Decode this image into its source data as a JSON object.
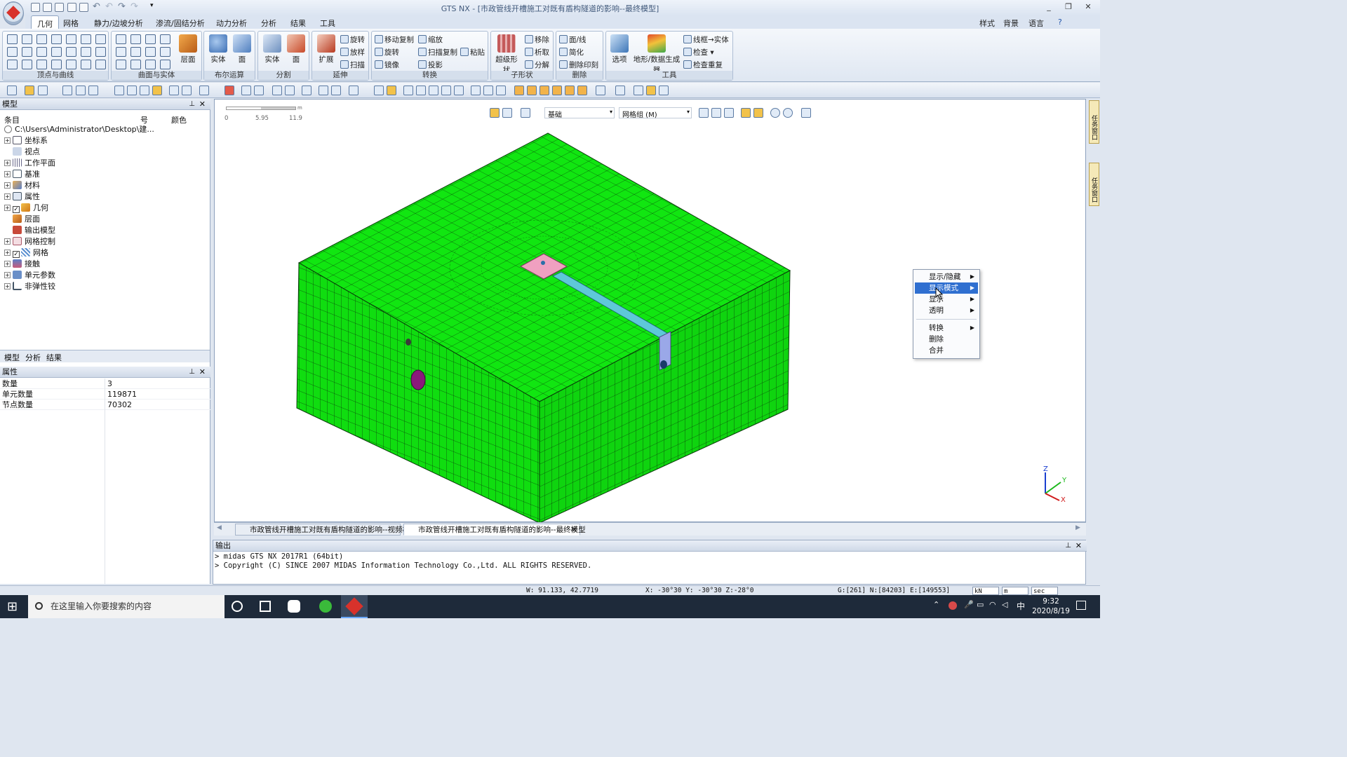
{
  "window": {
    "title": "GTS NX - [市政管线开槽施工对既有盾构隧道的影响--最终模型]",
    "controls": [
      "_",
      "❐",
      "✕"
    ]
  },
  "menu": {
    "tabs": [
      "几何",
      "网格",
      "静力/边坡分析",
      "渗流/固结分析",
      "动力分析",
      "分析",
      "结果",
      "工具"
    ],
    "right": [
      "样式",
      "背景",
      "语言"
    ]
  },
  "ribbon": {
    "groups": [
      "顶点与曲线",
      "曲面与实体",
      "布尔运算",
      "分割",
      "延伸",
      "转换",
      "子形状",
      "删除",
      "工具"
    ],
    "big_buttons": {
      "layer": "层面",
      "solid": "实体",
      "face": "面",
      "split_solid": "实体",
      "split_face": "面",
      "extrude": "扩展",
      "super_shape": "超级形状",
      "options": "选项",
      "terrain": "地形/数据生成器"
    },
    "extend": [
      "旋转",
      "放样",
      "扫描"
    ],
    "transform": [
      "移动复制",
      "缩放",
      "旋转",
      "扫描复制",
      "粘贴",
      "镜像",
      "投影"
    ],
    "subshape": [
      "移除",
      "析取",
      "分解"
    ],
    "delete": [
      "面/线",
      "简化",
      "删除印刻"
    ],
    "tools": [
      "线框→实体",
      "检查",
      "检查重复"
    ]
  },
  "model_panel": {
    "header": "模型",
    "columns": [
      "条目",
      "号",
      "颜色"
    ],
    "path": "C:\\Users\\Administrator\\Desktop\\建...",
    "items": [
      "坐标系",
      "视点",
      "工作平面",
      "基准",
      "材料",
      "属性",
      "几何",
      "层面",
      "输出模型",
      "网格控制",
      "网格",
      "接触",
      "单元参数",
      "非弹性铰"
    ],
    "bottom_tabs": [
      "模型",
      "分析",
      "结果"
    ]
  },
  "properties": {
    "header": "属性",
    "rows": [
      {
        "label": "数量",
        "value": "3"
      },
      {
        "label": "单元数量",
        "value": "119871"
      },
      {
        "label": "节点数量",
        "value": "70302"
      }
    ]
  },
  "viewport": {
    "scale_labels": [
      "0",
      "5.95",
      "11.9"
    ],
    "scale_unit": "m",
    "filter_a": "基础",
    "filter_b": "网格组 (M)",
    "axes": {
      "z": "Z",
      "y": "Y",
      "x": "X"
    }
  },
  "context_menu": {
    "items": [
      "显示/隐藏",
      "显示模式",
      "显示",
      "透明",
      "转换",
      "删除",
      "合并"
    ],
    "highlighted": "显示模式"
  },
  "doc_tabs": [
    "市政管线开槽施工对既有盾构隧道的影响--视频模型",
    "市政管线开槽施工对既有盾构隧道的影响--最终模型"
  ],
  "output": {
    "header": "输出",
    "lines": [
      "> midas GTS NX 2017R1 (64bit)",
      "> Copyright (C) SINCE 2007 MIDAS Information Technology Co.,Ltd. ALL RIGHTS RESERVED."
    ]
  },
  "status": {
    "w": "W: 91.133, 42.7719",
    "angles": "X: -30°30 Y: -30°30 Z:-28°0",
    "counts": "G:[261] N:[84203] E:[149553]",
    "units": [
      "kN",
      "m",
      "sec"
    ]
  },
  "side_tabs": [
    "任务窗口",
    "任务窗口"
  ],
  "taskbar": {
    "search_placeholder": "在这里输入你要搜索的内容",
    "time": "9:32",
    "date": "2020/8/19",
    "ime": "中"
  },
  "colors": {
    "mesh": "#11e611",
    "mesh_line": "#0a3a0a",
    "pipe": "#5ec8d8",
    "shaft": "#f0a0c0",
    "accent": "#2f6fd0"
  }
}
